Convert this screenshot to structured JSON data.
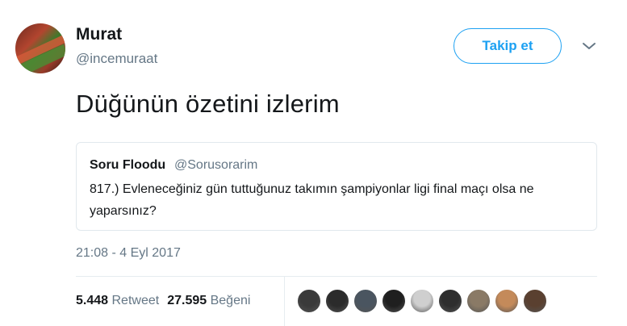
{
  "author": {
    "name": "Murat",
    "handle": "@incemuraat"
  },
  "follow_button": {
    "label": "Takip et"
  },
  "tweet": {
    "text": "Düğünün özetini izlerim",
    "timestamp": "21:08 - 4 Eyl 2017"
  },
  "quoted_tweet": {
    "name": "Soru Floodu",
    "handle": "@Sorusorarim",
    "text": "817.) Evleneceğiniz gün tuttuğunuz takımın şampiyonlar ligi final maçı olsa ne yaparsınız?"
  },
  "stats": {
    "retweets_count": "5.448",
    "retweets_label": "Retweet",
    "likes_count": "27.595",
    "likes_label": "Beğeni"
  },
  "likers": [
    {
      "name": "liker-avatar-1",
      "color": "#3a3a3a"
    },
    {
      "name": "liker-avatar-2",
      "color": "#2b2b2b"
    },
    {
      "name": "liker-avatar-3",
      "color": "#4a5560"
    },
    {
      "name": "liker-avatar-4",
      "color": "#1f1f1f"
    },
    {
      "name": "liker-avatar-5",
      "color": "#cfcfcf"
    },
    {
      "name": "liker-avatar-6",
      "color": "#2e2e2e"
    },
    {
      "name": "liker-avatar-7",
      "color": "#8a7a66"
    },
    {
      "name": "liker-avatar-8",
      "color": "#c48a5a"
    },
    {
      "name": "liker-avatar-9",
      "color": "#5a4030"
    }
  ],
  "colors": {
    "accent": "#1da1f2",
    "secondary_text": "#657786",
    "primary_text": "#14171a",
    "border": "#e1e8ed"
  }
}
